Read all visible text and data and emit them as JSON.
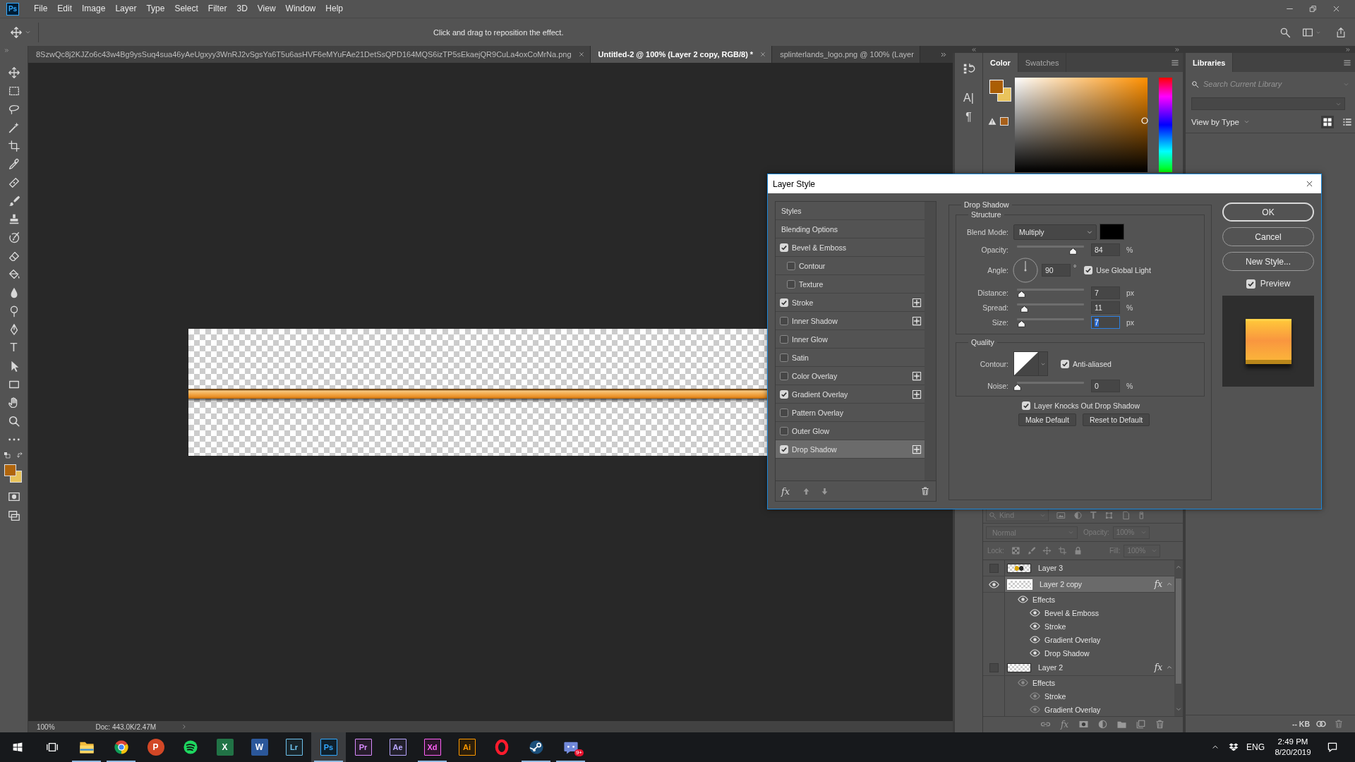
{
  "menu_bar": {
    "logo": "Ps",
    "items": [
      "File",
      "Edit",
      "Image",
      "Layer",
      "Type",
      "Select",
      "Filter",
      "3D",
      "View",
      "Window",
      "Help"
    ]
  },
  "options_bar": {
    "hint": "Click and drag to reposition the effect."
  },
  "document_tabs": [
    {
      "title": "8SzwQc8j2KJZo6c43w4Bg9ysSuq4sua46yAeUgxyy3WnRJ2vSgsYa6T5u6asHVF6eMYuFAe21DetSsQPD164MQS6izTP5sEkaejQR9CuLa4oxCoMrNa.png",
      "selected": false
    },
    {
      "title": "Untitled-2 @ 100% (Layer 2 copy, RGB/8) *",
      "selected": true
    },
    {
      "title": "splinterlands_logo.png @ 100% (Layer",
      "selected": false
    }
  ],
  "toolbar": {
    "type_tool": "T",
    "swatches": [
      {
        "kind": "foreground",
        "color": "#b0650c"
      },
      {
        "kind": "background",
        "color": "#e8c35a"
      }
    ]
  },
  "status_bar": {
    "zoom": "100%",
    "doc_info": "Doc: 443.0K/2.47M"
  },
  "panel_strip": {
    "glyphs": [
      "A|",
      "¶"
    ]
  },
  "color_panel": {
    "tabs": [
      {
        "label": "Color",
        "selected": true
      },
      {
        "label": "Swatches",
        "selected": false
      }
    ],
    "swatches": [
      {
        "kind": "foreground",
        "color": "#ab5e04"
      },
      {
        "kind": "background",
        "color": "#eac45c"
      },
      {
        "kind": "gamut",
        "color": "#a8601a"
      }
    ]
  },
  "libraries_panel": {
    "tab": "Libraries",
    "search": {
      "placeholder": "Search Current Library"
    },
    "view_by": "View by Type",
    "views": [
      {
        "kind": "grid",
        "selected": true
      },
      {
        "kind": "list",
        "selected": false
      }
    ],
    "storage": "-- KB"
  },
  "layers_panel": {
    "disabled": true,
    "filter": "Kind",
    "type_filter": "T",
    "blend_mode": "Normal",
    "opacity_label": "Opacity:",
    "opacity": "100%",
    "lock_label": "Lock:",
    "fill_label": "Fill:",
    "fill": "100%",
    "footer_fx": "fx",
    "layers": [
      {
        "name": "Layer 3",
        "kind": "logo",
        "visible": false,
        "selected": false
      },
      {
        "name": "Layer 2 copy",
        "kind": "bar",
        "visible": true,
        "selected": true,
        "badge": "fx",
        "expanded": true,
        "children": [
          {
            "name": "Effects",
            "visible": true,
            "children": [
              {
                "name": "Bevel & Emboss",
                "visible": true
              },
              {
                "name": "Stroke",
                "visible": true
              },
              {
                "name": "Gradient Overlay",
                "visible": true
              },
              {
                "name": "Drop Shadow",
                "visible": true
              }
            ]
          }
        ]
      },
      {
        "name": "Layer 2",
        "kind": "bar",
        "visible": false,
        "selected": false,
        "badge": "fx",
        "expanded": true,
        "children": [
          {
            "name": "Effects",
            "visible": true,
            "children": [
              {
                "name": "Stroke",
                "visible": true
              },
              {
                "name": "Gradient Overlay",
                "visible": true
              }
            ]
          }
        ]
      }
    ]
  },
  "dialog": {
    "title": "Layer Style",
    "footer_fx": "fx",
    "styles": [
      {
        "label": "Styles",
        "kind": "header",
        "selected": false
      },
      {
        "label": "Blending Options",
        "kind": "header",
        "selected": false
      },
      {
        "label": "Bevel & Emboss",
        "kind": "effect",
        "checked": true,
        "selected": false,
        "stackable": false
      },
      {
        "label": "Contour",
        "kind": "sub",
        "checked": false,
        "selected": false,
        "stackable": false
      },
      {
        "label": "Texture",
        "kind": "sub",
        "checked": false,
        "selected": false,
        "stackable": false
      },
      {
        "label": "Stroke",
        "kind": "effect",
        "checked": true,
        "selected": false,
        "stackable": true
      },
      {
        "label": "Inner Shadow",
        "kind": "effect",
        "checked": false,
        "selected": false,
        "stackable": true
      },
      {
        "label": "Inner Glow",
        "kind": "effect",
        "checked": false,
        "selected": false,
        "stackable": false
      },
      {
        "label": "Satin",
        "kind": "effect",
        "checked": false,
        "selected": false,
        "stackable": false
      },
      {
        "label": "Color Overlay",
        "kind": "effect",
        "checked": false,
        "selected": false,
        "stackable": true
      },
      {
        "label": "Gradient Overlay",
        "kind": "effect",
        "checked": true,
        "selected": false,
        "stackable": true
      },
      {
        "label": "Pattern Overlay",
        "kind": "effect",
        "checked": false,
        "selected": false,
        "stackable": false
      },
      {
        "label": "Outer Glow",
        "kind": "effect",
        "checked": false,
        "selected": false,
        "stackable": false
      },
      {
        "label": "Drop Shadow",
        "kind": "effect",
        "checked": true,
        "selected": true,
        "stackable": true
      }
    ],
    "options": {
      "title": "Drop Shadow",
      "structure": {
        "title": "Structure",
        "blend_label": "Blend Mode:",
        "blend_mode": "Multiply",
        "color": "#000000",
        "rows": [
          {
            "kind": "slider",
            "label": "Opacity:",
            "level": 0.84,
            "value": "84",
            "unit": "%",
            "focused": false
          },
          {
            "kind": "angle",
            "label": "Angle:",
            "value": "90",
            "unit": "°",
            "global_light": {
              "label": "Use Global Light",
              "checked": true
            }
          },
          {
            "kind": "slider",
            "label": "Distance:",
            "level": 0.06,
            "value": "7",
            "unit": "px",
            "focused": false
          },
          {
            "kind": "slider",
            "label": "Spread:",
            "level": 0.11,
            "value": "11",
            "unit": "%",
            "focused": false
          },
          {
            "kind": "slider",
            "label": "Size:",
            "level": 0.06,
            "value": "7",
            "unit": "px",
            "focused": true
          }
        ]
      },
      "quality": {
        "title": "Quality",
        "contour_label": "Contour:",
        "anti_aliased": {
          "label": "Anti-aliased",
          "checked": true
        },
        "noise": {
          "label": "Noise:",
          "level": 0,
          "value": "0",
          "unit": "%",
          "focused": false
        }
      },
      "knockout": {
        "label": "Layer Knocks Out Drop Shadow",
        "checked": true
      },
      "actions": [
        "Make Default",
        "Reset to Default"
      ]
    },
    "buttons": [
      {
        "label": "OK",
        "default": true
      },
      {
        "label": "Cancel",
        "default": false
      },
      {
        "label": "New Style...",
        "default": false
      }
    ],
    "preview": {
      "label": "Preview",
      "checked": true
    }
  },
  "taskbar": {
    "apps": [
      {
        "kind": "folder",
        "running": true,
        "selected": false
      },
      {
        "kind": "browser",
        "running": true,
        "selected": false
      },
      {
        "kind": "round",
        "label": "P",
        "color": "#d24726",
        "running": false,
        "selected": false
      },
      {
        "kind": "music",
        "running": false,
        "selected": false
      },
      {
        "kind": "tile",
        "label": "X",
        "color": "#217346",
        "running": false,
        "selected": false
      },
      {
        "kind": "tile",
        "label": "W",
        "color": "#2b579a",
        "running": false,
        "selected": false
      },
      {
        "kind": "adobe",
        "label": "Lr",
        "color": "#6fc3ee",
        "running": false,
        "selected": false
      },
      {
        "kind": "adobe",
        "label": "Ps",
        "color": "#31a8ff",
        "running": true,
        "selected": true
      },
      {
        "kind": "adobe",
        "label": "Pr",
        "color": "#d98cff",
        "running": false,
        "selected": false
      },
      {
        "kind": "adobe",
        "label": "Ae",
        "color": "#b8a6ff",
        "running": false,
        "selected": false
      },
      {
        "kind": "adobe",
        "label": "Xd",
        "color": "#ff61f6",
        "running": true,
        "selected": false
      },
      {
        "kind": "adobe",
        "label": "Ai",
        "color": "#ff9a00",
        "running": false,
        "selected": false
      },
      {
        "kind": "ring",
        "running": false,
        "selected": false
      },
      {
        "kind": "steam",
        "running": true,
        "selected": false
      },
      {
        "kind": "chat",
        "badge": "9+",
        "running": true,
        "selected": false
      }
    ],
    "language": "ENG",
    "time": "2:49 PM",
    "date": "8/20/2019"
  }
}
